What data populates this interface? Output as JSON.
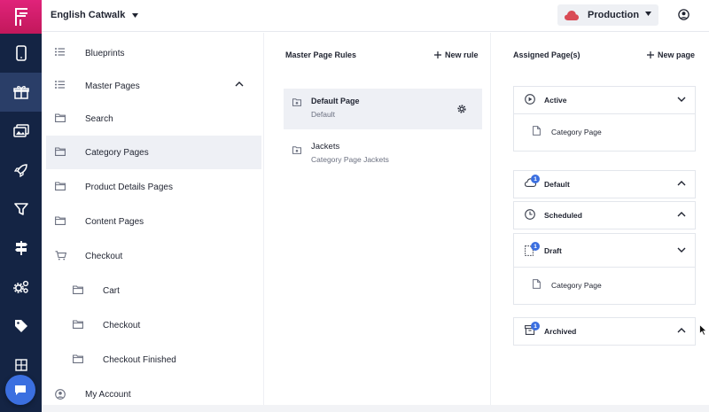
{
  "app": {
    "site_name": "English Catwalk",
    "environment": "Production",
    "accent": "#e0237a",
    "rail_bg": "#142444"
  },
  "rail": {
    "items": [
      {
        "icon": "mobile-icon"
      },
      {
        "icon": "gift-icon"
      },
      {
        "icon": "images-icon"
      },
      {
        "icon": "rocket-icon"
      },
      {
        "icon": "filter-icon"
      },
      {
        "icon": "signpost-icon"
      },
      {
        "icon": "gears-icon"
      },
      {
        "icon": "tag-icon"
      },
      {
        "icon": "grid-icon"
      }
    ]
  },
  "nav": {
    "items": [
      {
        "label": "Blueprints",
        "icon": "list-icon"
      },
      {
        "label": "Master Pages",
        "icon": "list-icon"
      },
      {
        "label": "Search",
        "icon": "folder-icon"
      },
      {
        "label": "Category Pages",
        "icon": "folder-icon"
      },
      {
        "label": "Product Details Pages",
        "icon": "folder-icon"
      },
      {
        "label": "Content Pages",
        "icon": "folder-icon"
      },
      {
        "label": "Checkout",
        "icon": "cart-icon"
      },
      {
        "label": "Cart",
        "icon": "folder-icon"
      },
      {
        "label": "Checkout",
        "icon": "folder-icon"
      },
      {
        "label": "Checkout Finished",
        "icon": "folder-icon"
      },
      {
        "label": "My Account",
        "icon": "user-icon"
      }
    ]
  },
  "rules": {
    "title": "Master Page Rules",
    "new_label": "New rule",
    "items": [
      {
        "title": "Default Page",
        "subtitle": "Default"
      },
      {
        "title": "Jackets",
        "subtitle": "Category Page Jackets"
      }
    ]
  },
  "assigned": {
    "title": "Assigned Page(s)",
    "new_label": "New page",
    "groups": [
      {
        "label": "Active",
        "page": "Category Page"
      },
      {
        "label": "Default",
        "badge": "1"
      },
      {
        "label": "Scheduled"
      },
      {
        "label": "Draft",
        "badge": "1",
        "page": "Category Page"
      },
      {
        "label": "Archived",
        "badge": "1"
      }
    ]
  }
}
